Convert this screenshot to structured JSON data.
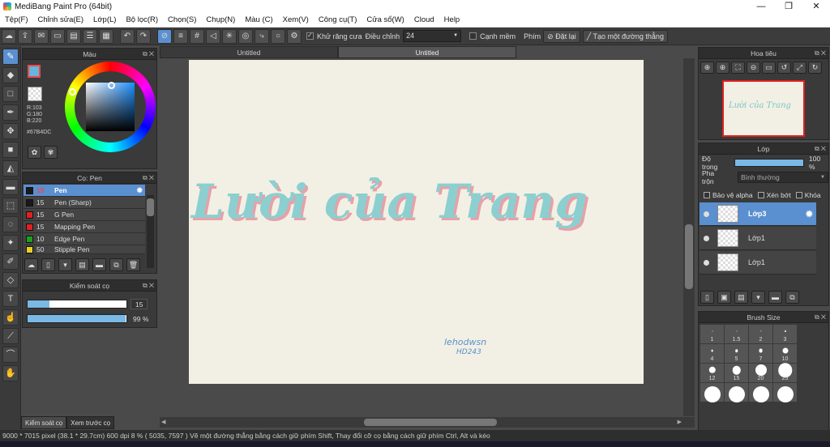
{
  "window": {
    "title": "MediBang Paint Pro (64bit)",
    "buttons": [
      "—",
      "❐",
      "✕"
    ]
  },
  "menu": [
    "Tệp(F)",
    "Chỉnh sửa(E)",
    "Lớp(L)",
    "Bộ lọc(R)",
    "Chọn(S)",
    "Chụp(N)",
    "Màu (C)",
    "Xem(V)",
    "Công cụ(T)",
    "Cửa sổ(W)",
    "Cloud",
    "Help"
  ],
  "toolbar": {
    "antialias_label": "Khử răng cưa",
    "correction_label": "Điều chỉnh",
    "correction_value": "24",
    "edge_label": "Cạnh mềm",
    "key_label": "Phím",
    "reset_button": "Đặt lại",
    "straight_line_button": "Tạo một đường thẳng"
  },
  "color_panel": {
    "title": "Màu",
    "r": "R:103",
    "g": "G:180",
    "b": "B:220",
    "hex": "#67B4DC",
    "fg_color": "#67b4dc"
  },
  "brush_panel": {
    "title": "Cọ: Pen",
    "brushes": [
      {
        "size": "15",
        "name": "Pen",
        "color": "#1a1a1a"
      },
      {
        "size": "15",
        "name": "Pen (Sharp)",
        "color": "#1a1a1a"
      },
      {
        "size": "15",
        "name": "G Pen",
        "color": "#e02020"
      },
      {
        "size": "15",
        "name": "Mapping Pen",
        "color": "#e02020"
      },
      {
        "size": "10",
        "name": "Edge Pen",
        "color": "#1ea01e"
      },
      {
        "size": "50",
        "name": "Stipple Pen",
        "color": "#e8d020"
      }
    ]
  },
  "control_panel": {
    "title": "Kiểm soát cọ",
    "size_value": "15",
    "size_fraction": 0.22,
    "opacity_value": "99 %",
    "opacity_fraction": 0.99
  },
  "left_tabs": [
    "Kiểm soát cọ",
    "Xem trước cọ"
  ],
  "doc_tabs": [
    "Untitled",
    "Untitled"
  ],
  "canvas": {
    "main_text": "Lười của Trang",
    "signature_line1": "lehodwsn",
    "signature_line2": "HD243"
  },
  "navigator": {
    "title": "Hoa tiêu",
    "thumb_text": "Lười của Trang"
  },
  "layer_panel": {
    "title": "Lớp",
    "opacity_label": "Độ trong",
    "opacity_value": "100 %",
    "blend_label": "Pha trộn",
    "blend_value": "Bình thường",
    "protect_alpha": "Bảo vệ alpha",
    "clipping": "Xén bớt",
    "lock": "Khóa",
    "layers": [
      "Lớp3",
      "Lớp1",
      "Lớp1"
    ]
  },
  "brush_size_panel": {
    "title": "Brush Size",
    "sizes": [
      "1",
      "1.5",
      "2",
      "3",
      "4",
      "5",
      "7",
      "10",
      "12",
      "15",
      "20",
      "25",
      "",
      "",
      "",
      ""
    ]
  },
  "status": {
    "text": "9000 * 7015 pixel   (38.1 * 29.7cm)   600 dpi   8 %   ( 5035, 7597 )   Vẽ một đường thẳng bằng cách giữ phím Shift, Thay đổi cỡ cọ bằng cách giữ phím Ctrl, Alt và kéo"
  }
}
